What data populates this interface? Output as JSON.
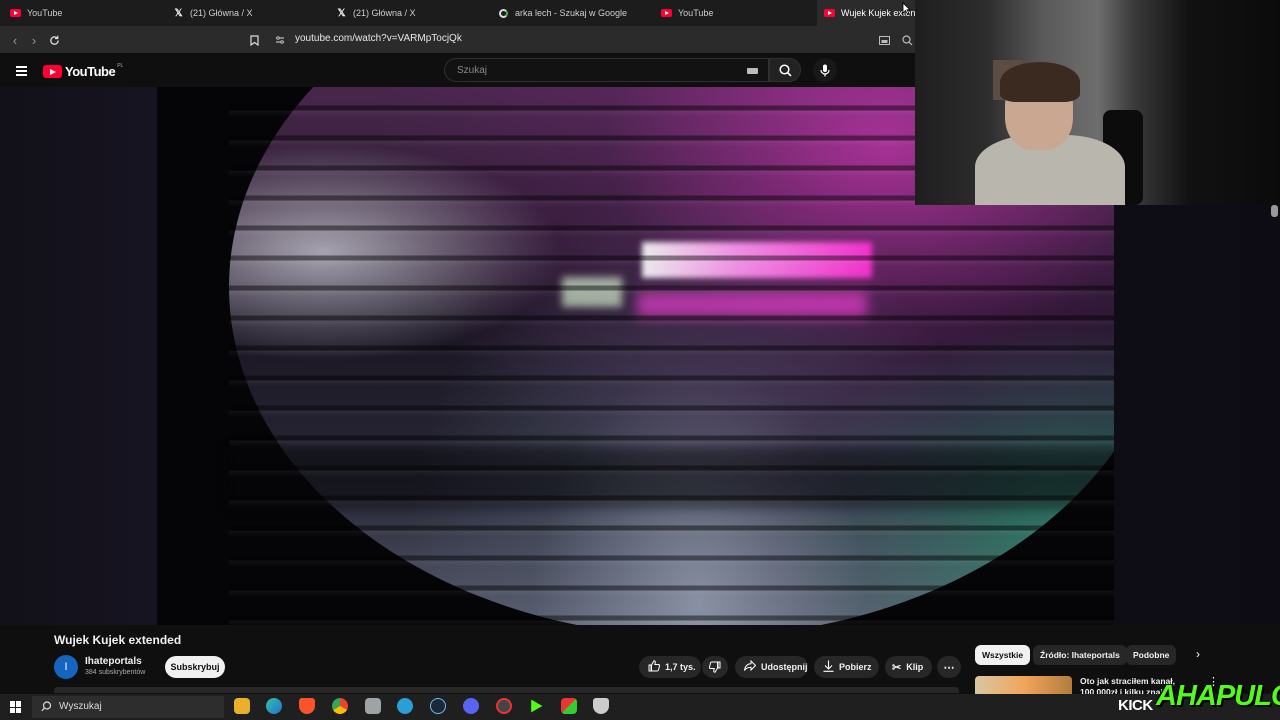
{
  "tabs": [
    {
      "title": "YouTube",
      "icon": "youtube-icon",
      "active": false
    },
    {
      "title": "(21) Główna / X",
      "icon": "x-icon",
      "active": false
    },
    {
      "title": "(21) Główna / X",
      "icon": "x-icon",
      "active": false
    },
    {
      "title": "arka lech - Szukaj w Google",
      "icon": "google-icon",
      "active": false
    },
    {
      "title": "YouTube",
      "icon": "youtube-icon",
      "active": false
    },
    {
      "title": "Wujek Kujek extended",
      "icon": "youtube-icon",
      "active": true
    }
  ],
  "address_bar": {
    "url": "youtube.com/watch?v=VARMpTocjQk"
  },
  "youtube": {
    "logo_text": "YouTube",
    "country_code": "PL",
    "search_placeholder": "Szukaj"
  },
  "video": {
    "title": "Wujek Kujek extended",
    "channel": {
      "avatar_letter": "I",
      "name": "Ihateportals",
      "subscribers": "384 subskrybentów"
    },
    "subscribe_label": "Subskrybuj",
    "actions": {
      "likes": "1,7 tys.",
      "share": "Udostępnij",
      "download": "Pobierz",
      "clip": "Klip"
    }
  },
  "filters": {
    "chips": [
      "Wszystkie",
      "Źródło: Ihateportals",
      "Podobne"
    ]
  },
  "recommendation": {
    "title": "Oto jak straciłem kanał, 100 000zł i kilku znajo"
  },
  "overlay": {
    "kick": "KICK",
    "streamer": "AHAPULCO"
  },
  "taskbar": {
    "search_label": "Wyszukaj"
  },
  "colors": {
    "youtube_red": "#ff0033",
    "kick_green": "#53fc18",
    "background": "#0f0f0f"
  }
}
